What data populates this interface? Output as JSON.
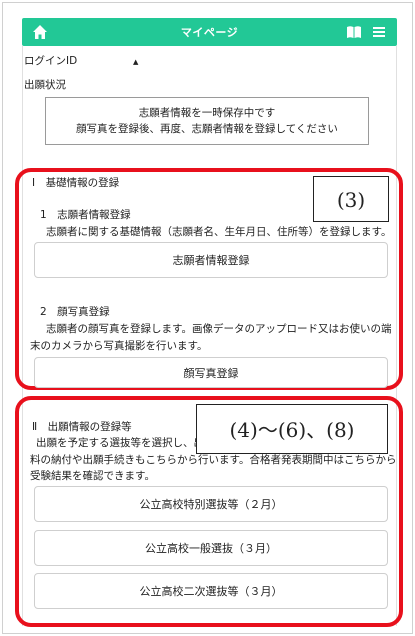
{
  "header": {
    "title": "マイページ"
  },
  "login": {
    "label": "ログインID",
    "value": "▲"
  },
  "status": {
    "label": "出願状況",
    "notice_line1": "志願者情報を一時保存中です",
    "notice_line2": "顔写真を登録後、再度、志願者情報を登録してください"
  },
  "section1": {
    "heading": "Ⅰ　基礎情報の登録",
    "callout": "(3)",
    "item1_title": "1　志願者情報登録",
    "item1_desc": "志願者に関する基礎情報（志願者名、生年月日、住所等）を登録します。",
    "item1_button": "志願者情報登録",
    "item2_title": "2　顔写真登録",
    "item2_desc_line1": "志願者の顔写真を登録します。画像データのアップロード又はお使いの端",
    "item2_desc_line2": "末のカメラから写真撮影を行います。",
    "item2_button": "顔写真登録"
  },
  "section2": {
    "heading": "Ⅱ　出願情報の登録等",
    "callout": "(4)～(6)、(8)",
    "desc_line1": "出願を予定する選抜等を選択し、出",
    "desc_line2": "料の納付や出願手続きもこちらから行います。合格者発表期間中はこちらから",
    "desc_line3": "受験結果を確認できます。",
    "buttons": [
      "公立高校特別選抜等（２月）",
      "公立高校一般選抜（３月）",
      "公立高校二次選抜等（３月）"
    ]
  },
  "colors": {
    "header_bg": "#22c896",
    "highlight": "#e8101c"
  }
}
